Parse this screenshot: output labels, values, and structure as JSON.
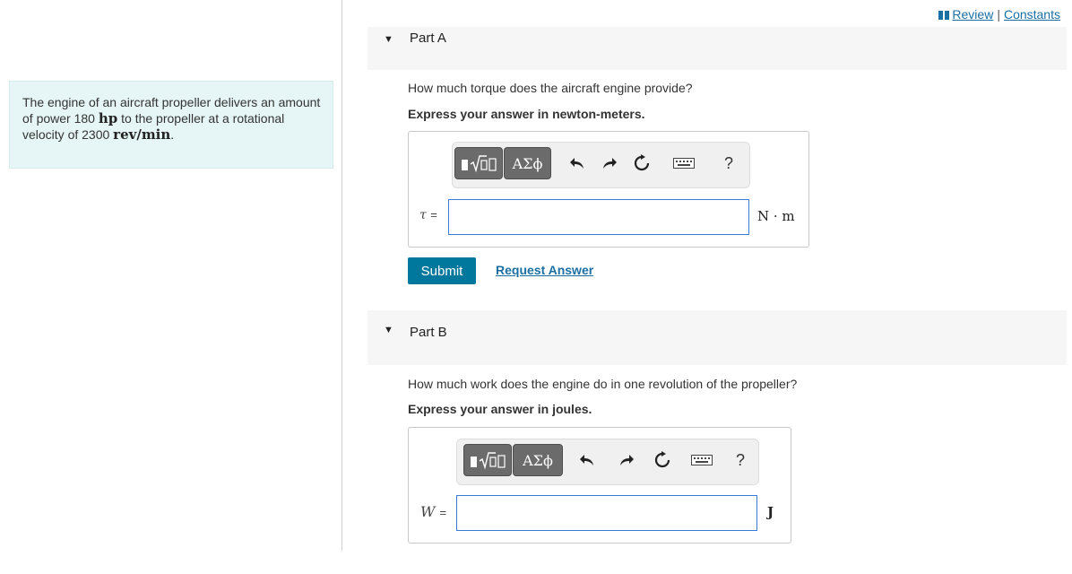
{
  "problem": {
    "text_1": "The engine of an aircraft propeller delivers an amount of power 180 ",
    "unit_power": "hp",
    "text_2": " to the propeller at a rotational velocity of 2300 ",
    "unit_velocity": "rev/min",
    "text_3": "."
  },
  "top_links": {
    "review": "Review",
    "separator": "|",
    "constants": "Constants"
  },
  "parts": [
    {
      "label": "Part A",
      "question": "How much torque does the aircraft engine provide?",
      "instruction": "Express your answer in newton-meters.",
      "variable": "τ",
      "equals": "=",
      "value": "",
      "unit": "N · m",
      "submit_label": "Submit",
      "request_label": "Request Answer"
    },
    {
      "label": "Part B",
      "question": "How much work does the engine do in one revolution of the propeller?",
      "instruction": "Express your answer in joules.",
      "variable": "W",
      "equals": "=",
      "value": "",
      "unit": "J"
    }
  ],
  "toolbar": {
    "greek_label": "ΑΣϕ",
    "help_label": "?",
    "icons": [
      "templates-icon",
      "greek-symbols-icon",
      "undo-icon",
      "redo-icon",
      "reset-icon",
      "keyboard-icon",
      "help-icon"
    ]
  },
  "colors": {
    "accent": "#00789d",
    "link": "#1a6fa3",
    "problem_bg": "#e6f5f5",
    "input_border": "#3a7bd5"
  }
}
